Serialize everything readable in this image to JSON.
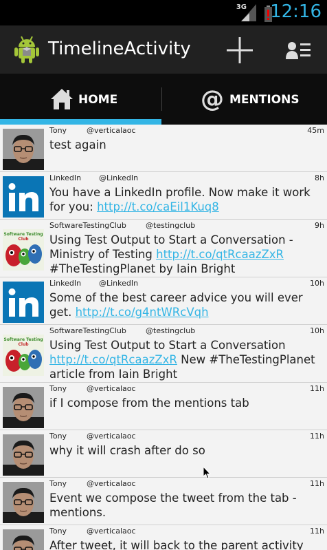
{
  "status": {
    "network": "3G",
    "clock": "12:16"
  },
  "app": {
    "title": "TimelineActivity"
  },
  "tabs": [
    {
      "label": "HOME",
      "selected": true
    },
    {
      "label": "MENTIONS",
      "selected": false
    }
  ],
  "tweets": [
    {
      "name": "Tony",
      "handle": "@verticalaoc",
      "time": "45m",
      "avatar": "tony-photo",
      "parts": [
        {
          "t": "test again"
        }
      ]
    },
    {
      "name": "LinkedIn",
      "handle": "@LinkedIn",
      "time": "8h",
      "avatar": "linkedin-logo",
      "parts": [
        {
          "t": "You have a LinkedIn profile. Now make it work for you: "
        },
        {
          "t": "http://t.co/caEil1Kuq8",
          "link": true
        }
      ]
    },
    {
      "name": "SoftwareTestingClub",
      "handle": "@testingclub",
      "time": "9h",
      "avatar": "testingclub-logo",
      "parts": [
        {
          "t": "Using Test Output to Start a Conversation - Ministry of Testing "
        },
        {
          "t": "http://t.co/qtRcaazZxR",
          "link": true
        },
        {
          "t": " #TheTestingPlanet by Iain Bright"
        }
      ]
    },
    {
      "name": "LinkedIn",
      "handle": "@LinkedIn",
      "time": "10h",
      "avatar": "linkedin-logo",
      "parts": [
        {
          "t": "Some of the best career advice you will ever get. "
        },
        {
          "t": "http://t.co/g4ntWRcVqh",
          "link": true
        }
      ]
    },
    {
      "name": "SoftwareTestingClub",
      "handle": "@testingclub",
      "time": "10h",
      "avatar": "testingclub-logo",
      "parts": [
        {
          "t": "Using Test Output to Start a Conversation "
        },
        {
          "t": "http://t.co/qtRcaazZxR",
          "link": true
        },
        {
          "t": " New #TheTestingPlanet article from Iain Bright"
        }
      ]
    },
    {
      "name": "Tony",
      "handle": "@verticalaoc",
      "time": "11h",
      "avatar": "tony-photo",
      "parts": [
        {
          "t": "if I compose from the mentions tab"
        }
      ]
    },
    {
      "name": "Tony",
      "handle": "@verticalaoc",
      "time": "11h",
      "avatar": "tony-photo",
      "parts": [
        {
          "t": "why it will crash after do so"
        }
      ]
    },
    {
      "name": "Tony",
      "handle": "@verticalaoc",
      "time": "11h",
      "avatar": "tony-photo",
      "parts": [
        {
          "t": "Event we compose the tweet from the tab - mentions."
        }
      ]
    },
    {
      "name": "Tony",
      "handle": "@verticalaoc",
      "time": "11h",
      "avatar": "tony-photo",
      "parts": [
        {
          "t": "After tweet, it will back to the parent activity and"
        }
      ]
    }
  ],
  "colors": {
    "accent": "#33b5e5",
    "actionbar": "#212121",
    "tabbar": "#0d0d0d",
    "list_bg": "#f3f3f3"
  }
}
